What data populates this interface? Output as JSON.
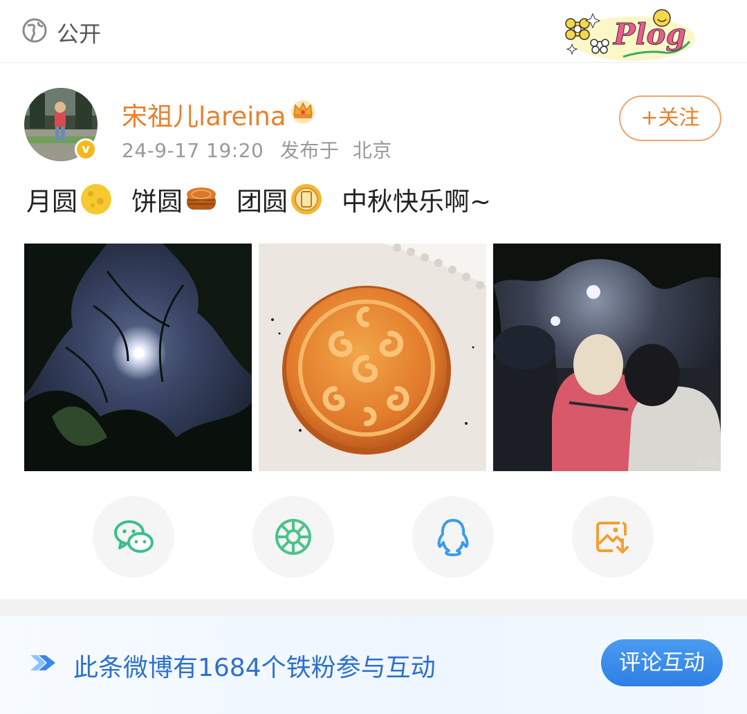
{
  "topbar": {
    "visibility_label": "公开",
    "sticker_text": "Plog"
  },
  "user": {
    "name": "宋祖儿lareina",
    "verified_mark": "v",
    "timestamp": "24-9-17 19:20",
    "location_prefix": "发布于",
    "location": "北京",
    "follow_label": "+关注"
  },
  "post": {
    "text_parts": [
      "月圆",
      "饼圆",
      "团圆",
      "中秋快乐啊~"
    ],
    "emojis": [
      "full-moon-emoji",
      "mooncake-emoji",
      "tuanyuan-emoji"
    ]
  },
  "photos": [
    {
      "name": "photo-moon-through-trees"
    },
    {
      "name": "photo-mooncake"
    },
    {
      "name": "photo-family-moon-viewing",
      "watermark": "微博@"
    }
  ],
  "share": [
    {
      "icon": "wechat-icon",
      "color": "#3cbf8a"
    },
    {
      "icon": "moments-icon",
      "color": "#4cc38a"
    },
    {
      "icon": "qq-icon",
      "color": "#3a9cf0"
    },
    {
      "icon": "save-image-icon",
      "color": "#f0a032"
    }
  ],
  "banner": {
    "text": "此条微博有1684个铁粉参与互动",
    "button_label": "评论互动"
  },
  "colors": {
    "accent_orange": "#e8802b",
    "banner_blue": "#2d6fd1",
    "button_blue": "#2e7fe6"
  }
}
